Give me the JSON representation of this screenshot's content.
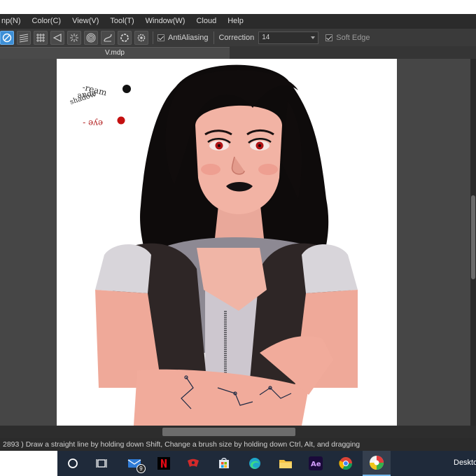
{
  "menu": {
    "items": [
      "np(N)",
      "Color(C)",
      "View(V)",
      "Tool(T)",
      "Window(W)",
      "Cloud",
      "Help"
    ]
  },
  "toolbar": {
    "buttons": [
      "no-fill-icon",
      "hatch-icon",
      "grid-icon",
      "flat-fill-icon",
      "radial-lines-icon",
      "concentric-icon",
      "curve-icon",
      "circle-icon",
      "settings-icon"
    ],
    "antialiasing_label": "AntiAliasing",
    "correction_label": "Correction",
    "correction_value": "14",
    "soft_edge_label": "Soft Edge"
  },
  "document": {
    "tab_title": "V.mdp"
  },
  "canvas": {
    "note_lines_1": "-ream",
    "note_lines_2": "ande",
    "note_lines_3": "shadow",
    "note_eye": "eye -"
  },
  "statusbar": {
    "text": "2893 )   Draw a straight line by holding down Shift, Change a brush size by holding down Ctrl, Alt, and dragging"
  },
  "taskbar": {
    "mail_badge": "9",
    "desktop_label": "Deskto"
  },
  "colors": {
    "accent": "#3d8fd6",
    "menubar": "#2b2b2b",
    "workspace": "#464646",
    "taskbar": "#1f2a3a"
  }
}
